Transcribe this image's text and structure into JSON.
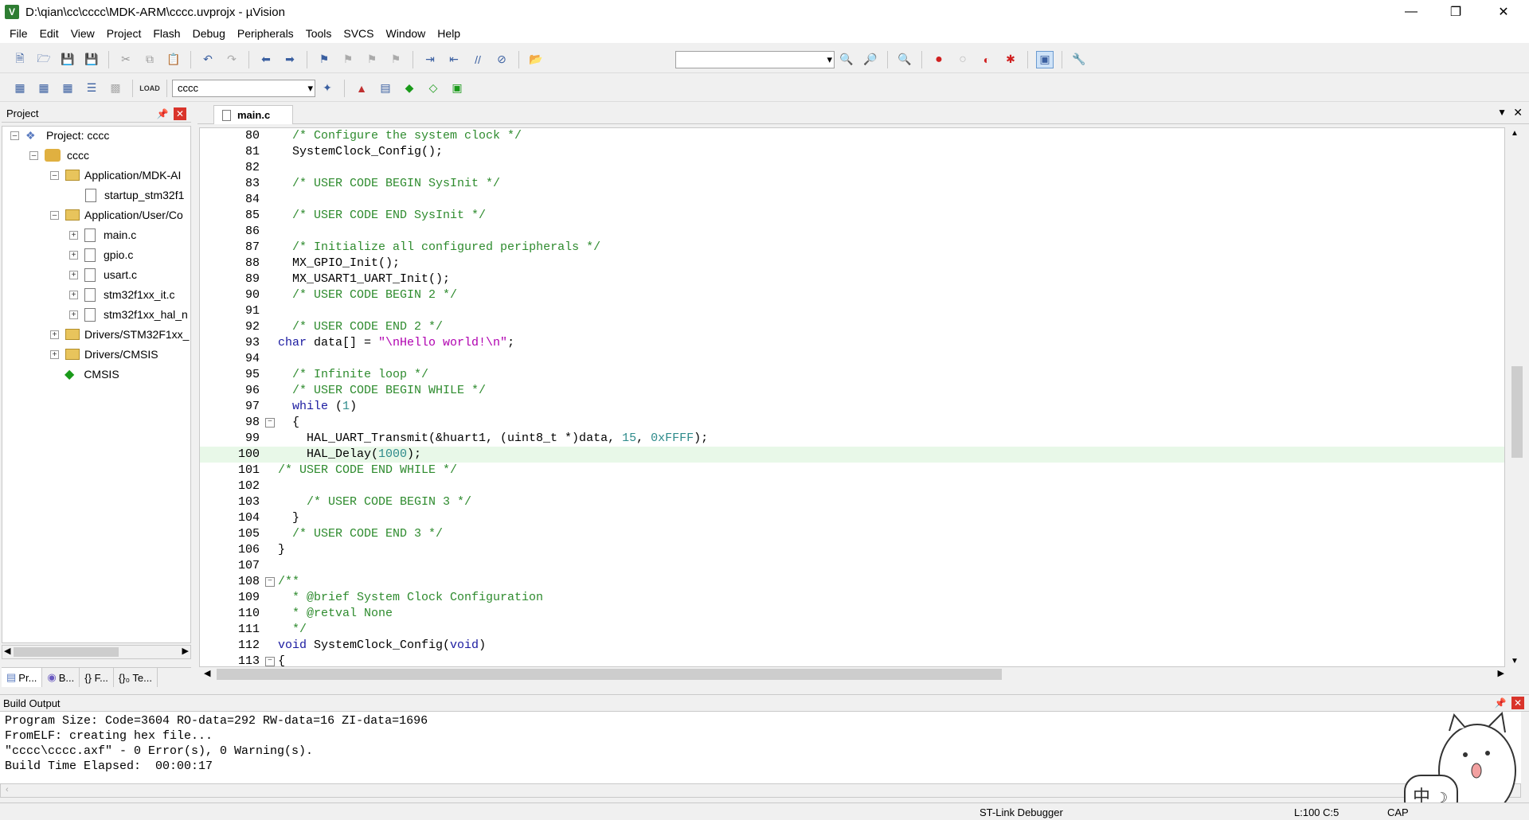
{
  "window": {
    "title": "D:\\qian\\cc\\cccc\\MDK-ARM\\cccc.uvprojx - µVision"
  },
  "menu": [
    "File",
    "Edit",
    "View",
    "Project",
    "Flash",
    "Debug",
    "Peripherals",
    "Tools",
    "SVCS",
    "Window",
    "Help"
  ],
  "toolbar2": {
    "target": "cccc"
  },
  "project_panel": {
    "title": "Project",
    "tree": [
      {
        "label": "Project: cccc"
      },
      {
        "label": "cccc"
      },
      {
        "label": "Application/MDK-AI"
      },
      {
        "label": "startup_stm32f1"
      },
      {
        "label": "Application/User/Co"
      },
      {
        "label": "main.c"
      },
      {
        "label": "gpio.c"
      },
      {
        "label": "usart.c"
      },
      {
        "label": "stm32f1xx_it.c"
      },
      {
        "label": "stm32f1xx_hal_n"
      },
      {
        "label": "Drivers/STM32F1xx_"
      },
      {
        "label": "Drivers/CMSIS"
      },
      {
        "label": "CMSIS"
      }
    ],
    "tabs": [
      "Pr...",
      "B...",
      "{} F...",
      "{}₀ Te..."
    ]
  },
  "editor": {
    "active_tab": "main.c",
    "lines": [
      {
        "n": "80",
        "t": "  /* Configure the system clock */"
      },
      {
        "n": "81",
        "t": "  SystemClock_Config();"
      },
      {
        "n": "82",
        "t": ""
      },
      {
        "n": "83",
        "t": "  /* USER CODE BEGIN SysInit */"
      },
      {
        "n": "84",
        "t": ""
      },
      {
        "n": "85",
        "t": "  /* USER CODE END SysInit */"
      },
      {
        "n": "86",
        "t": ""
      },
      {
        "n": "87",
        "t": "  /* Initialize all configured peripherals */"
      },
      {
        "n": "88",
        "t": "  MX_GPIO_Init();"
      },
      {
        "n": "89",
        "t": "  MX_USART1_UART_Init();"
      },
      {
        "n": "90",
        "t": "  /* USER CODE BEGIN 2 */"
      },
      {
        "n": "91",
        "t": ""
      },
      {
        "n": "92",
        "t": "  /* USER CODE END 2 */"
      },
      {
        "n": "93",
        "t": "char data[] = \"\\nHello world!\\n\";"
      },
      {
        "n": "94",
        "t": ""
      },
      {
        "n": "95",
        "t": "  /* Infinite loop */"
      },
      {
        "n": "96",
        "t": "  /* USER CODE BEGIN WHILE */"
      },
      {
        "n": "97",
        "t": "  while (1)"
      },
      {
        "n": "98",
        "t": "  {"
      },
      {
        "n": "99",
        "t": "    HAL_UART_Transmit(&huart1, (uint8_t *)data, 15, 0xFFFF);"
      },
      {
        "n": "100",
        "t": "    HAL_Delay(1000);"
      },
      {
        "n": "101",
        "t": "/* USER CODE END WHILE */"
      },
      {
        "n": "102",
        "t": ""
      },
      {
        "n": "103",
        "t": "    /* USER CODE BEGIN 3 */"
      },
      {
        "n": "104",
        "t": "  }"
      },
      {
        "n": "105",
        "t": "  /* USER CODE END 3 */"
      },
      {
        "n": "106",
        "t": "}"
      },
      {
        "n": "107",
        "t": ""
      },
      {
        "n": "108",
        "t": "/**"
      },
      {
        "n": "109",
        "t": "  * @brief System Clock Configuration"
      },
      {
        "n": "110",
        "t": "  * @retval None"
      },
      {
        "n": "111",
        "t": "  */"
      },
      {
        "n": "112",
        "t": "void SystemClock_Config(void)"
      },
      {
        "n": "113",
        "t": "{"
      }
    ]
  },
  "build_output": {
    "title": "Build Output",
    "lines": [
      "Program Size: Code=3604 RO-data=292 RW-data=16 ZI-data=1696",
      "FromELF: creating hex file...",
      "\"cccc\\cccc.axf\" - 0 Error(s), 0 Warning(s).",
      "Build Time Elapsed:  00:00:17"
    ]
  },
  "status": {
    "debugger": "ST-Link Debugger",
    "position": "L:100 C:5",
    "caps": "CAP"
  },
  "colors": {
    "comment": "#2e8b2e",
    "keyword": "#1a1aa0",
    "string": "#b000b0",
    "number": "#2e8b8b"
  }
}
